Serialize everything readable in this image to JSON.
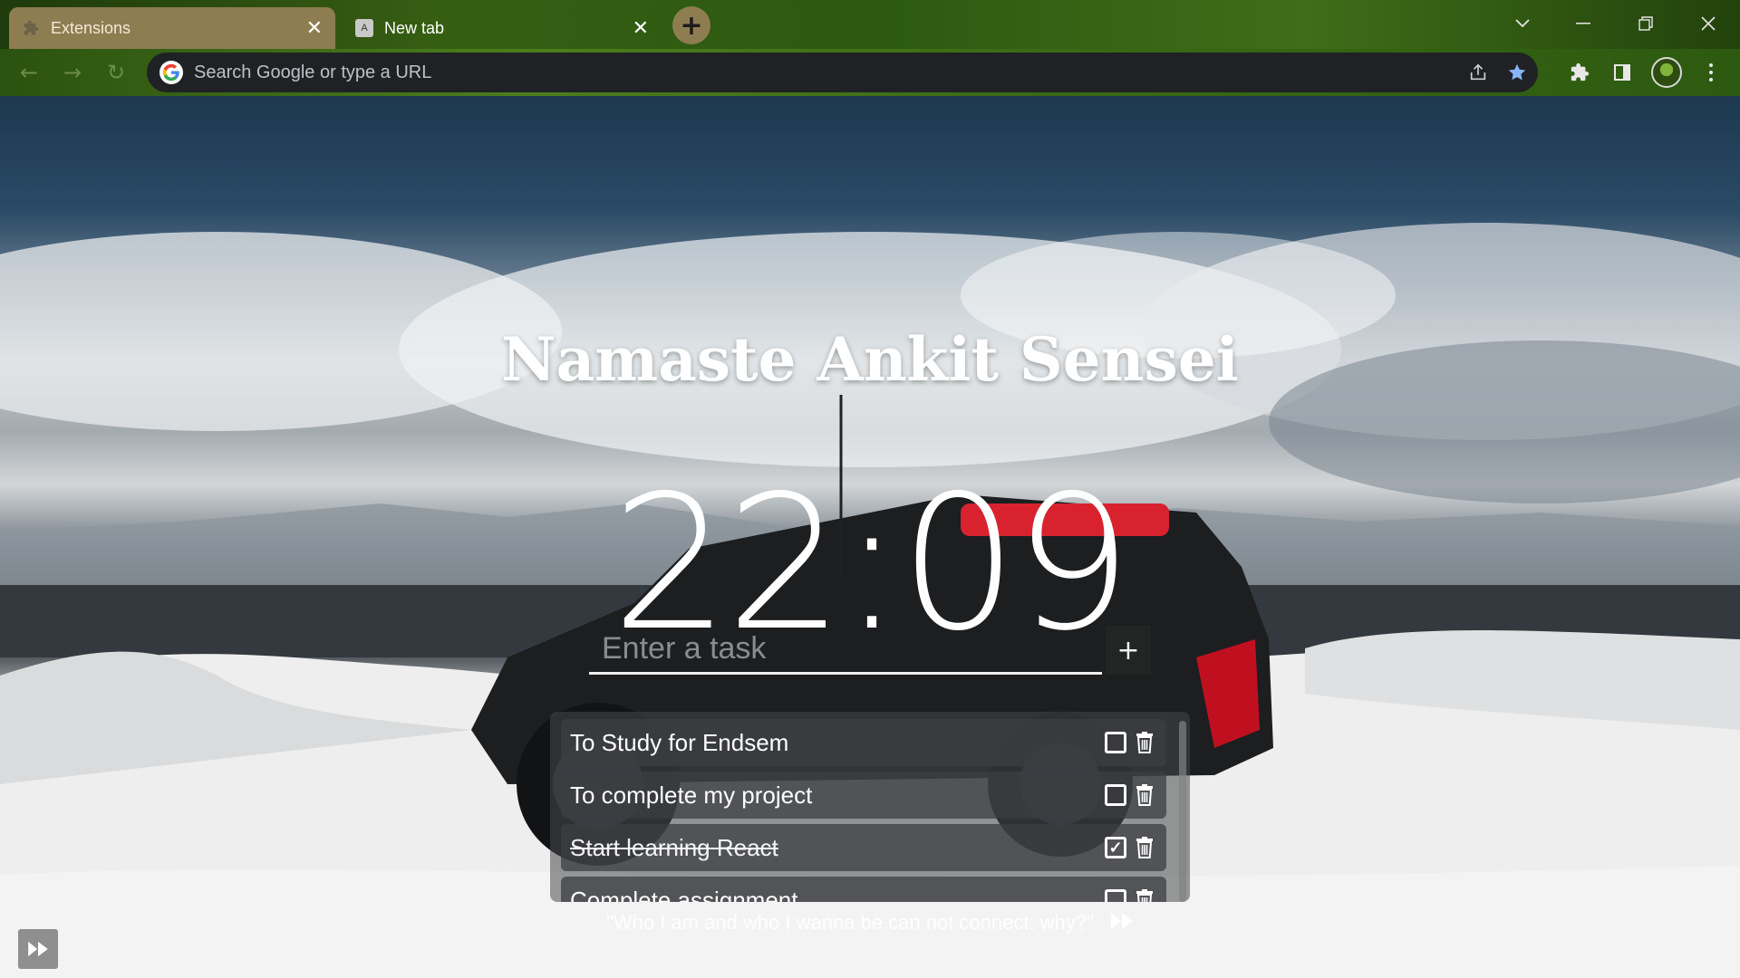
{
  "tabs": [
    {
      "label": "Extensions",
      "favicon": "puzzle-icon",
      "active": false
    },
    {
      "label": "New tab",
      "favicon": "A",
      "active": true
    }
  ],
  "omnibox": {
    "placeholder": "Search Google or type a URL"
  },
  "greeting": "Namaste Ankit Sensei",
  "clock": "22:09",
  "task_input": {
    "placeholder": "Enter a task",
    "add_label": "+"
  },
  "tasks": [
    {
      "text": "To Study for Endsem",
      "done": false
    },
    {
      "text": "To complete my project",
      "done": false
    },
    {
      "text": "Start learning React",
      "done": true
    },
    {
      "text": "Complete assignment",
      "done": false
    }
  ],
  "quote": "\"Who I am and who I wanna be can not connect; why?\"",
  "colors": {
    "tab_active": "#8f7d52",
    "omnibox": "#202124",
    "bookmark_star": "#8ab4f8"
  }
}
